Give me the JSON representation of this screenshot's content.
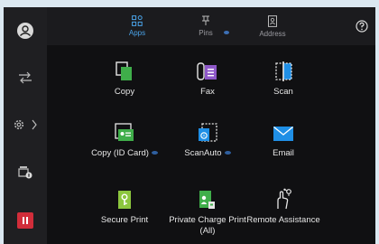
{
  "tabs": [
    {
      "label": "Apps",
      "icon": "apps-grid-icon",
      "active": true
    },
    {
      "label": "Pins",
      "icon": "pin-icon",
      "active": false
    },
    {
      "label": "Address",
      "icon": "address-book-icon",
      "active": false
    }
  ],
  "help_icon": "question-icon",
  "sidebar": [
    {
      "icon": "user-icon"
    },
    {
      "icon": "job-status-icon"
    },
    {
      "icon": "settings-gear-icon"
    },
    {
      "icon": "printer-info-icon"
    },
    {
      "icon": "stop-icon"
    }
  ],
  "apps": [
    {
      "label": "Copy",
      "icon": "copy-icon"
    },
    {
      "label": "Fax",
      "icon": "fax-icon"
    },
    {
      "label": "Scan",
      "icon": "scan-icon"
    },
    {
      "label": "Copy (ID Card)",
      "icon": "id-card-icon"
    },
    {
      "label": "ScanAuto",
      "icon": "scan-auto-icon"
    },
    {
      "label": "Email",
      "icon": "email-icon"
    },
    {
      "label": "Secure Print",
      "icon": "secure-print-icon"
    },
    {
      "label": "Private Charge Print (All)",
      "icon": "private-charge-print-icon"
    },
    {
      "label": "Remote Assistance",
      "icon": "remote-assistance-icon"
    }
  ],
  "colors": {
    "accent": "#4aa3e8",
    "stop": "#d12d3a",
    "background": "#101012"
  }
}
